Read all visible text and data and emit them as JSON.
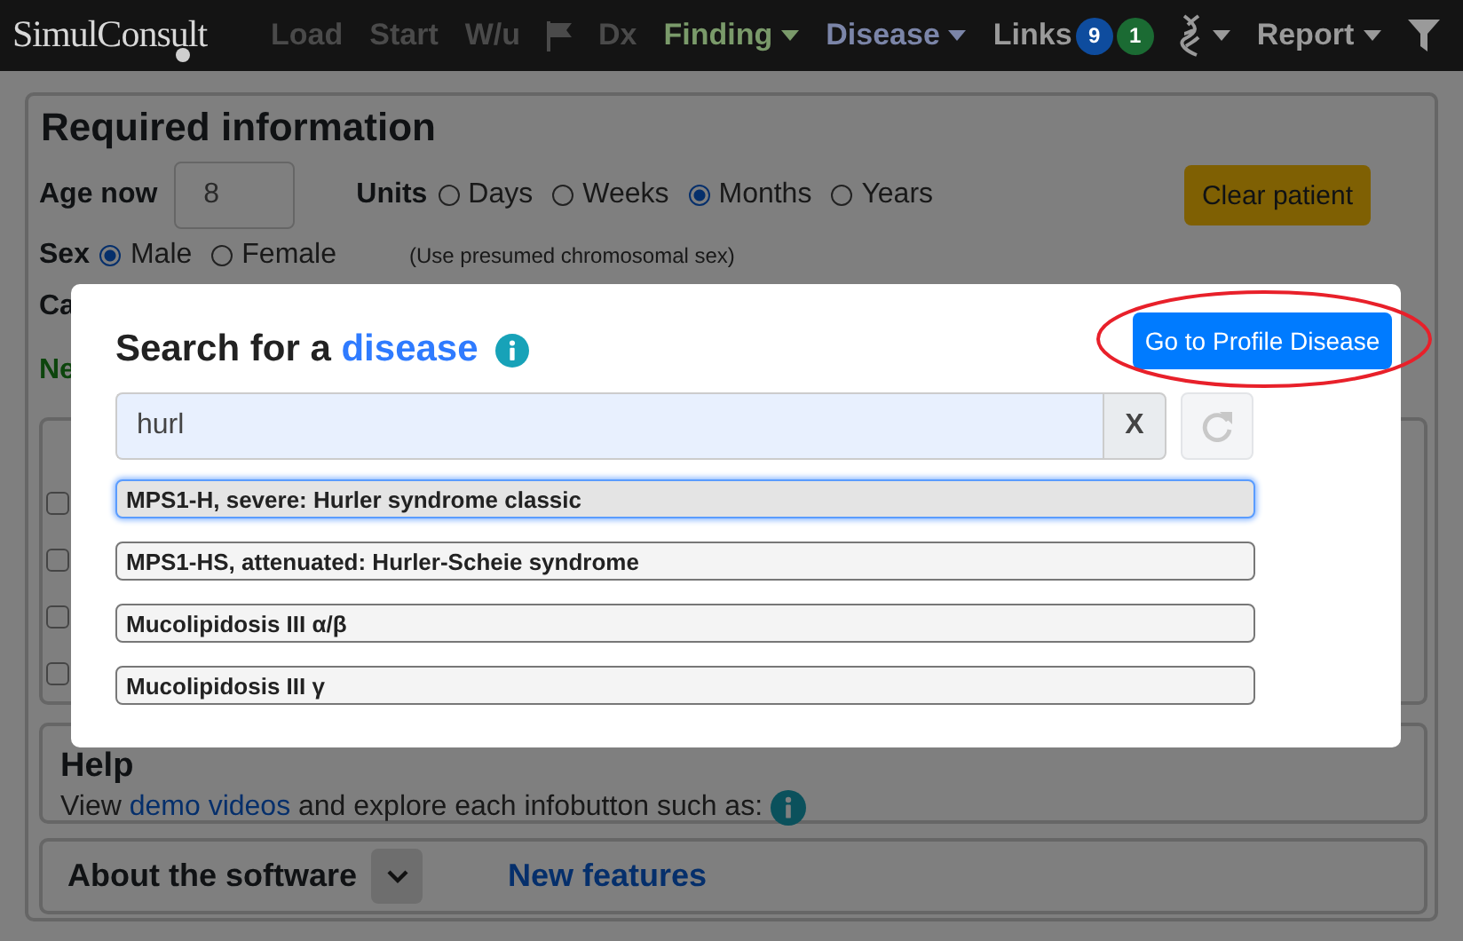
{
  "navbar": {
    "logo": "SimulConsult",
    "items": [
      {
        "kind": "label",
        "label": "Load",
        "disabled": true,
        "dropdown": false
      },
      {
        "kind": "label",
        "label": "Start",
        "disabled": true,
        "dropdown": false
      },
      {
        "kind": "label",
        "label": "W/u",
        "disabled": true,
        "dropdown": false
      },
      {
        "kind": "flag",
        "disabled": true,
        "dropdown": false
      },
      {
        "kind": "label",
        "label": "Dx",
        "disabled": true,
        "dropdown": false
      },
      {
        "kind": "label",
        "label": "Finding",
        "disabled": false,
        "dropdown": true,
        "color": "#7a9a6a"
      },
      {
        "kind": "label",
        "label": "Disease",
        "disabled": false,
        "dropdown": true,
        "color": "#7b85a8"
      },
      {
        "kind": "label",
        "label": "Links",
        "disabled": false,
        "dropdown": false,
        "badges": [
          {
            "text": "9",
            "color": "#0e4c9e"
          },
          {
            "text": "1",
            "color": "#1b6b33"
          }
        ]
      },
      {
        "kind": "dna",
        "disabled": false,
        "dropdown": true
      },
      {
        "kind": "label",
        "label": "Report",
        "disabled": false,
        "dropdown": true
      },
      {
        "kind": "filter",
        "disabled": false,
        "dropdown": false
      }
    ]
  },
  "required": {
    "title": "Required information",
    "age": {
      "label": "Age now",
      "value": "8"
    },
    "units": {
      "label": "Units",
      "options": [
        {
          "label": "Days",
          "selected": false
        },
        {
          "label": "Weeks",
          "selected": false
        },
        {
          "label": "Months",
          "selected": true
        },
        {
          "label": "Years",
          "selected": false
        }
      ]
    },
    "clear_button": "Clear patient",
    "sex": {
      "label": "Sex",
      "options": [
        {
          "label": "Male",
          "selected": true
        },
        {
          "label": "Female",
          "selected": false
        }
      ],
      "note": "(Use presumed chromosomal sex)"
    },
    "partial_label": "Ca",
    "partial_link": "Ne"
  },
  "section_c": {
    "rows": [
      {
        "checked": false
      },
      {
        "checked": false
      },
      {
        "checked": false
      },
      {
        "checked": false
      }
    ]
  },
  "help": {
    "title": "Help",
    "text_before": "View",
    "link": "demo videos",
    "text_after": "and explore each infobutton such as:"
  },
  "about": {
    "title": "About the software",
    "expanded": false,
    "link": "New features"
  },
  "modal": {
    "title": "Search for a",
    "title_highlight": "disease",
    "action_button": "Go to Profile Disease",
    "action_button_circled": true,
    "search": {
      "value": "hurl"
    },
    "clear_button": "X",
    "refresh_disabled": true,
    "results": [
      {
        "label": "MPS1-H, severe: Hurler syndrome classic",
        "selected": true
      },
      {
        "label": "MPS1-HS, attenuated: Hurler-Scheie syndrome",
        "selected": false
      },
      {
        "label": "Mucolipidosis III α/β",
        "selected": false
      },
      {
        "label": "Mucolipidosis III γ",
        "selected": false
      }
    ]
  }
}
